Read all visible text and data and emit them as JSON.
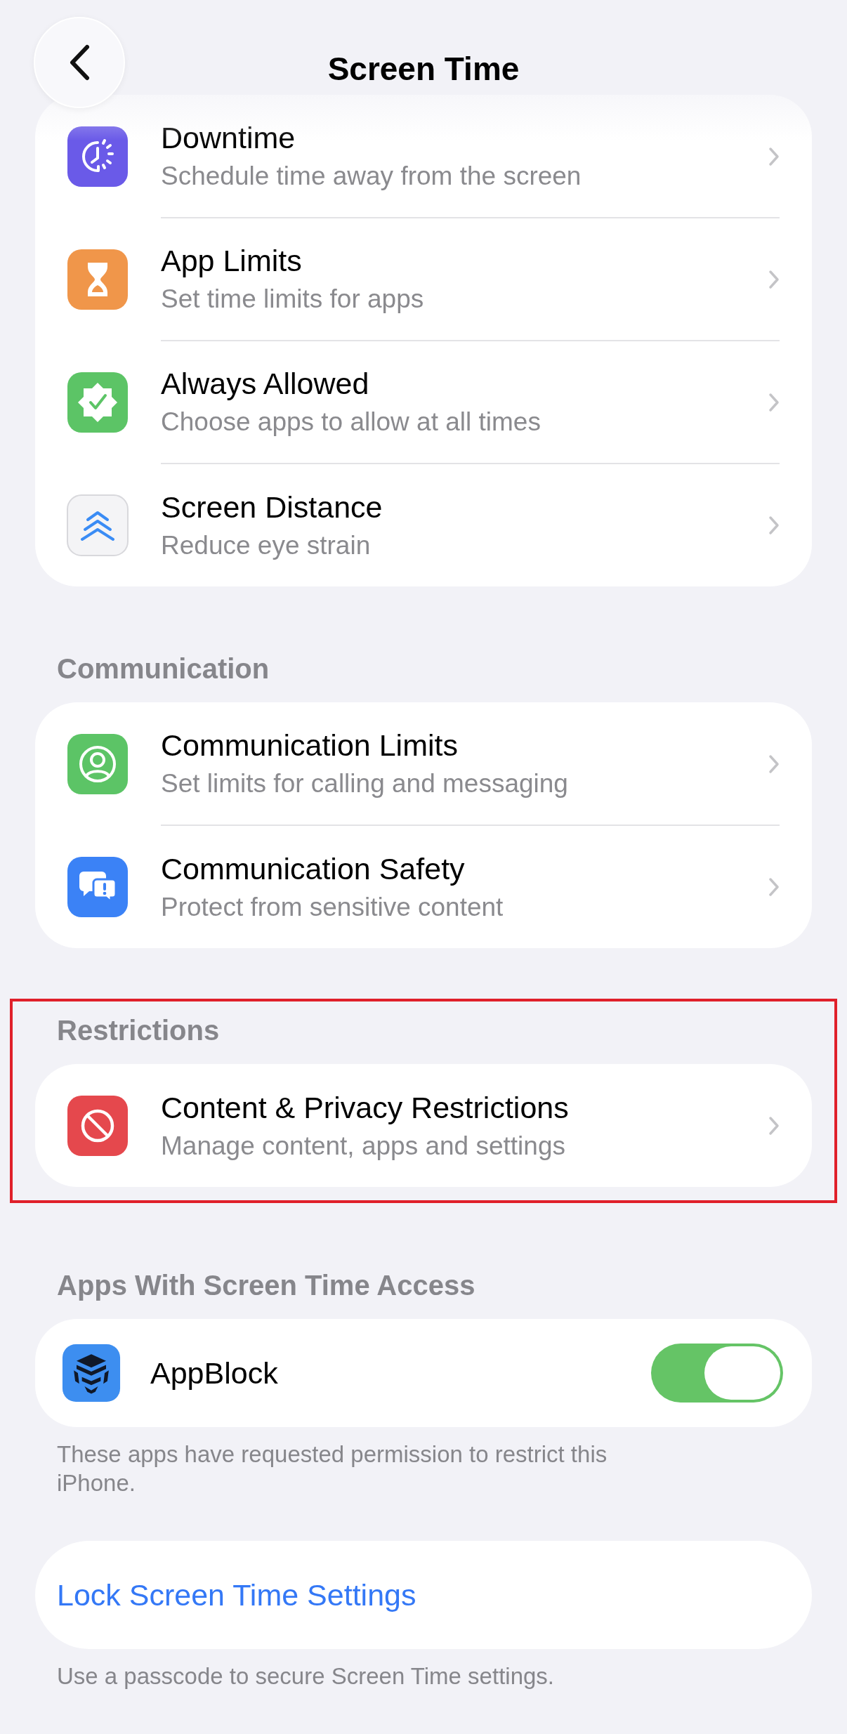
{
  "nav": {
    "title": "Screen Time"
  },
  "sections": [
    {
      "kind": "list",
      "highlighted": false,
      "rows": [
        {
          "kind": "clock",
          "title": "Downtime",
          "subtitle": "Schedule time away from the screen"
        },
        {
          "kind": "hourglass",
          "title": "App Limits",
          "subtitle": "Set time limits for apps"
        },
        {
          "kind": "badge",
          "title": "Always Allowed",
          "subtitle": "Choose apps to allow at all times"
        },
        {
          "kind": "chevrons",
          "title": "Screen Distance",
          "subtitle": "Reduce eye strain"
        }
      ]
    },
    {
      "kind": "list",
      "header": "Communication",
      "highlighted": false,
      "rows": [
        {
          "kind": "person",
          "title": "Communication Limits",
          "subtitle": "Set limits for calling and messaging"
        },
        {
          "kind": "bubbles",
          "title": "Communication Safety",
          "subtitle": "Protect from sensitive content"
        }
      ]
    },
    {
      "kind": "list",
      "header": "Restrictions",
      "highlighted": true,
      "rows": [
        {
          "kind": "blocked",
          "title": "Content & Privacy Restrictions",
          "subtitle": "Manage content, apps and settings"
        }
      ]
    },
    {
      "kind": "apps",
      "header": "Apps With Screen Time Access",
      "highlighted": false,
      "apps": [
        {
          "name": "AppBlock",
          "on": true
        }
      ],
      "footer": "These apps have requested permission to restrict this iPhone."
    },
    {
      "kind": "link",
      "highlighted": false,
      "link": "Lock Screen Time Settings",
      "footer": "Use a passcode to secure Screen Time settings."
    }
  ]
}
